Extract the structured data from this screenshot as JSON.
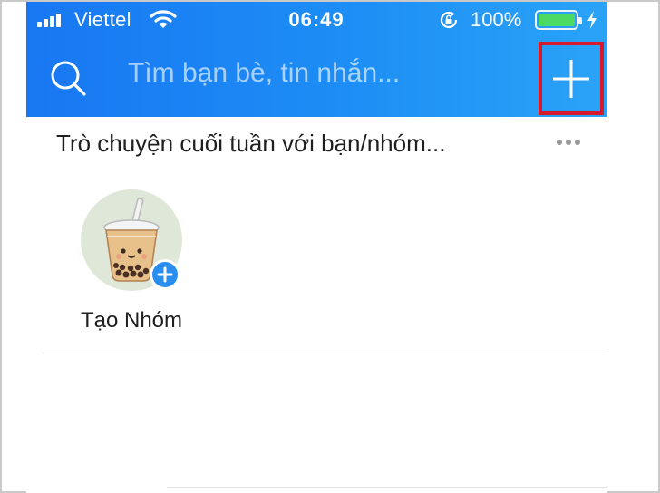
{
  "status_bar": {
    "carrier": "Viettel",
    "time": "06:49",
    "battery_percent": "100%",
    "battery_level": 1.0,
    "icons": [
      "signal-icon",
      "wifi-icon",
      "rotation-lock-icon",
      "battery-icon",
      "charging-bolt-icon"
    ]
  },
  "header": {
    "search_placeholder": "Tìm bạn bè, tin nhắn...",
    "search_icon": "search-icon",
    "add_icon": "plus-icon",
    "accent": "#1d8ef5",
    "highlight_color": "#d41a2c"
  },
  "section": {
    "title": "Trò chuyện cuối tuần với bạn/nhóm...",
    "more_icon": "more-dots-icon"
  },
  "group_suggestion": {
    "label": "Tạo Nhóm",
    "avatar": "bubble-tea-avatar",
    "badge_icon": "plus-badge-icon"
  }
}
